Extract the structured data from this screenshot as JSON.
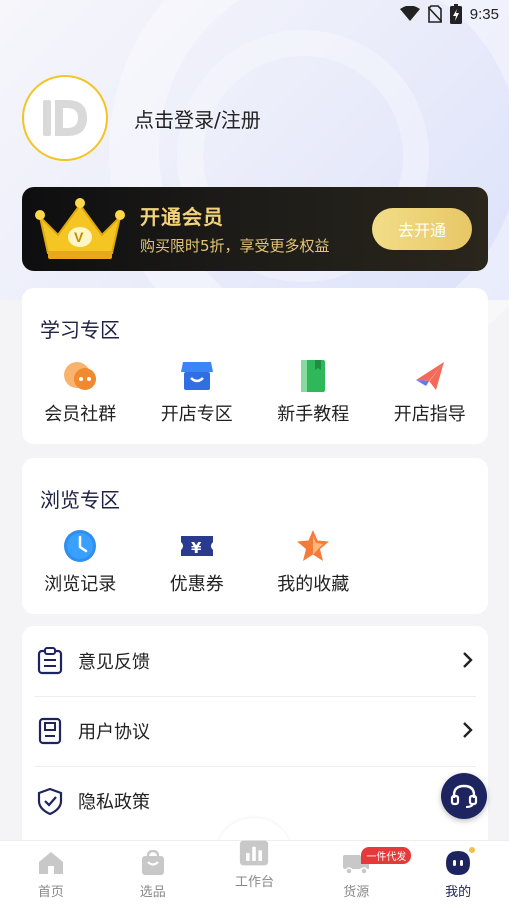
{
  "status_bar": {
    "time": "9:35",
    "icons": [
      "wifi-icon",
      "no-sim-icon",
      "battery-charging-icon"
    ]
  },
  "profile": {
    "login_text": "点击登录/注册",
    "avatar_icon": "brand-logo-id"
  },
  "vip_banner": {
    "title": "开通会员",
    "subtitle": "购买限时5折，享受更多权益",
    "button": "去开通",
    "icon": "crown-icon"
  },
  "learning": {
    "title": "学习专区",
    "items": [
      {
        "label": "会员社群",
        "icon": "chat-bubble-icon"
      },
      {
        "label": "开店专区",
        "icon": "store-icon"
      },
      {
        "label": "新手教程",
        "icon": "book-icon"
      },
      {
        "label": "开店指导",
        "icon": "paper-plane-icon"
      }
    ]
  },
  "browse": {
    "title": "浏览专区",
    "items": [
      {
        "label": "浏览记录",
        "icon": "clock-icon"
      },
      {
        "label": "优惠券",
        "icon": "coupon-icon"
      },
      {
        "label": "我的收藏",
        "icon": "star-icon"
      }
    ]
  },
  "menu": {
    "items": [
      {
        "label": "意见反馈",
        "icon": "clipboard-icon"
      },
      {
        "label": "用户协议",
        "icon": "document-icon"
      },
      {
        "label": "隐私政策",
        "icon": "shield-icon"
      }
    ]
  },
  "tabbar": {
    "items": [
      {
        "label": "首页",
        "icon": "home-icon"
      },
      {
        "label": "选品",
        "icon": "shopping-bag-icon"
      },
      {
        "label": "工作台",
        "icon": "bar-chart-icon"
      },
      {
        "label": "货源",
        "icon": "truck-icon",
        "badge": "一件代发"
      },
      {
        "label": "我的",
        "icon": "profile-face-icon",
        "active": true
      }
    ]
  },
  "colors": {
    "accent": "#1d2460",
    "vip_gold": "#f3d27a",
    "badge_red": "#e63a3a",
    "avatar_ring": "#f3c425"
  }
}
